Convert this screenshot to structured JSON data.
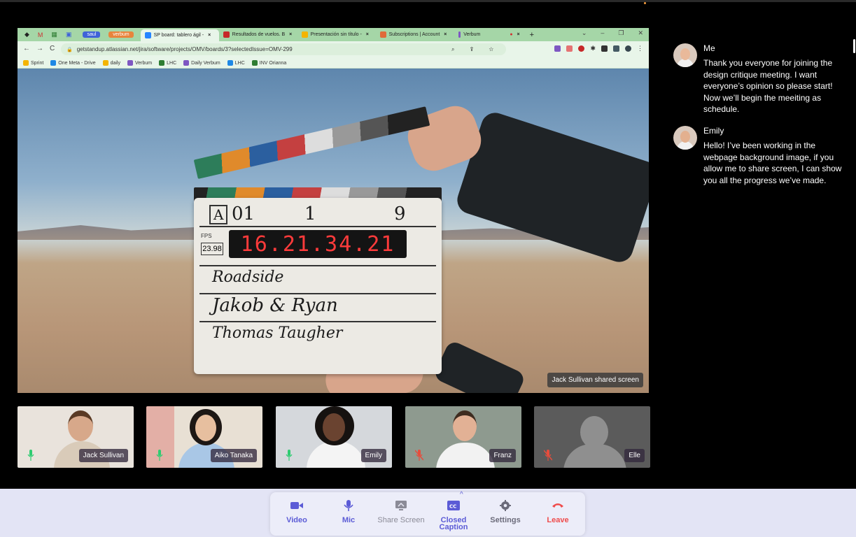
{
  "browser": {
    "tabs": [
      {
        "label": "saul",
        "type": "pill",
        "color": "#3f63d8"
      },
      {
        "label": "verbum",
        "type": "pill",
        "color": "#e8843c"
      },
      {
        "label": "SP board: tablero ágil -",
        "active": true
      },
      {
        "label": "Resultados de vuelos. B"
      },
      {
        "label": "Presentación sin título -"
      },
      {
        "label": "Subscriptions | Account"
      },
      {
        "label": "Verbum"
      }
    ],
    "url": "getstandup.atlassian.net/jira/software/projects/OMV/boards/3?selectedIssue=OMV-299",
    "bookmarks": [
      "Sprint",
      "One Meta - Drive",
      "daily",
      "Verbum",
      "LHC",
      "Daily Verbum",
      "LHC",
      "INV Orianna"
    ]
  },
  "shared_screen": {
    "label": "Jack Sullivan shared screen",
    "slate": {
      "roll": "A",
      "scene_a": "01",
      "scene_b": "1",
      "take": "9",
      "fps_label": "FPS",
      "fps": "23.98",
      "timecode": "16.21.34.21",
      "prod": "Roadside",
      "dir": "Jakob & Ryan",
      "cam": "Thomas Taugher"
    }
  },
  "participants": [
    {
      "name": "Jack Sullivan",
      "mic": "on",
      "bg": "#e9e3dc",
      "skin": "#d7a88a",
      "hair": "#5a3a24",
      "shirt": "#d9cbb9"
    },
    {
      "name": "Aiko Tanaka",
      "mic": "on",
      "bg": "#e8e0d4",
      "skin": "#e7bf9f",
      "hair": "#1d1714",
      "shirt": "#a9c7e6"
    },
    {
      "name": "Emily",
      "mic": "on",
      "bg": "#d5d8dc",
      "skin": "#6a4330",
      "hair": "#161210",
      "shirt": "#f4f4f4"
    },
    {
      "name": "Franz",
      "mic": "off",
      "bg": "#8e9a8f",
      "skin": "#e2b195",
      "hair": "#3e2c20",
      "shirt": "#f2f2f2"
    },
    {
      "name": "Elle",
      "mic": "off",
      "bg": "#5b5b5b",
      "skin": "#8f8f8f",
      "hair": "#8f8f8f",
      "shirt": "#8f8f8f"
    }
  ],
  "chat": [
    {
      "sender": "Me",
      "text": "Thank you everyone for joining the design critique meeting. I want everyone’s opinion so please start! Now we’ll begin the meeiting as schedule."
    },
    {
      "sender": "Emily",
      "text": "Hello! I’ve been working in the webpage background image, if you allow me to share screen, I can show you all the progress we’ve made."
    }
  ],
  "controls": [
    {
      "label": "Video",
      "icon": "video-camera-icon",
      "color": "#5b5bd6"
    },
    {
      "label": "Mic",
      "icon": "microphone-icon",
      "color": "#5b5bd6"
    },
    {
      "label": "Share Screen",
      "icon": "share-screen-icon",
      "color": "#8b8b97"
    },
    {
      "label": "Closed Caption",
      "icon": "closed-caption-icon",
      "color": "#5b5bd6"
    },
    {
      "label": "Settings",
      "icon": "gear-icon",
      "color": "#6b6b7a"
    },
    {
      "label": "Leave",
      "icon": "phone-hangup-icon",
      "color": "#ef4b4b"
    }
  ],
  "colors": {
    "accent": "#5b5bd6",
    "danger": "#ef4b4b",
    "mic_on": "#2ecc71",
    "mic_off": "#e74c3c"
  }
}
